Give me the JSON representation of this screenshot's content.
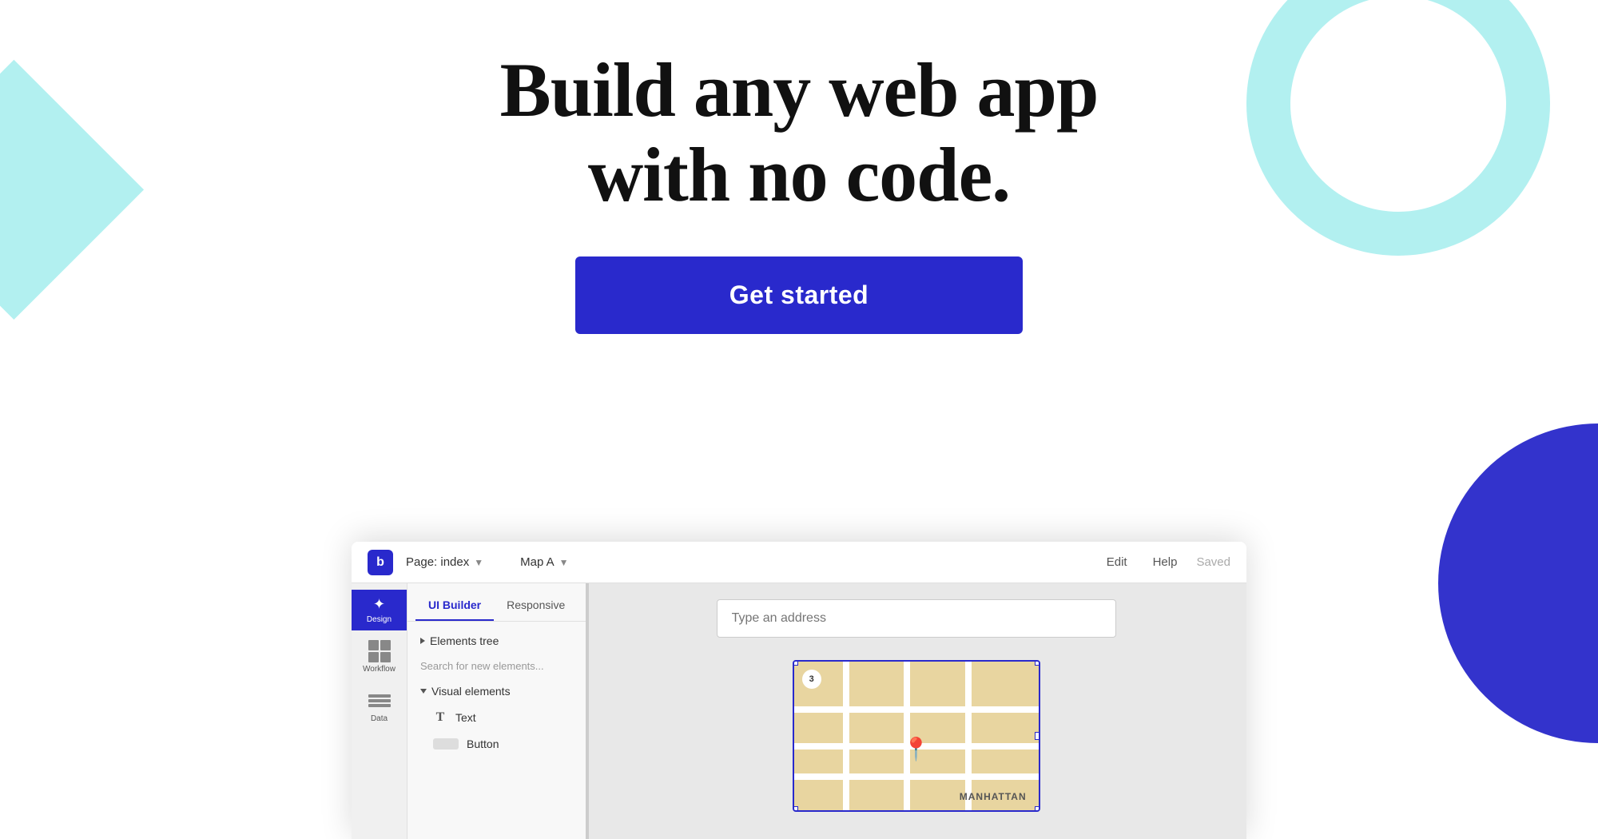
{
  "hero": {
    "title_line1": "Build any web app",
    "title_line2": "with no code.",
    "cta_label": "Get started"
  },
  "app": {
    "toolbar": {
      "logo_text": "b",
      "page_label": "Page: index",
      "map_label": "Map A",
      "edit_label": "Edit",
      "help_label": "Help",
      "saved_label": "Saved"
    },
    "sidebar": {
      "tab_ui_builder": "UI Builder",
      "tab_responsive": "Responsive",
      "elements_tree_label": "Elements tree",
      "search_placeholder": "Search for new elements...",
      "visual_elements_label": "Visual elements",
      "text_element_label": "Text",
      "button_element_label": "Button"
    },
    "icon_sidebar": {
      "design_label": "Design",
      "workflow_label": "Workflow",
      "data_label": "Data"
    },
    "canvas": {
      "address_placeholder": "Type an address",
      "map_number": "3",
      "map_location_text": "MANHATTAN"
    }
  }
}
